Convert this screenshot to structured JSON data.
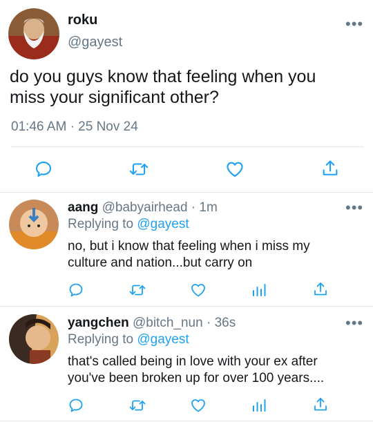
{
  "tweet": {
    "display_name": "roku",
    "handle": "@gayest",
    "text_line1": "do you guys know that feeling when you",
    "text_line2": "miss your significant other?",
    "time": "01:46 AM",
    "date_sep": "·",
    "date": "25 Nov 24"
  },
  "replies": [
    {
      "display_name": "aang",
      "handle": "@babyairhead",
      "sep": "·",
      "age": "1m",
      "replying_prefix": "Replying to",
      "replying_to": "@gayest",
      "text_line1": "no, but i know that feeling when i miss my",
      "text_line2": "culture and nation...but carry on"
    },
    {
      "display_name": "yangchen",
      "handle": "@bitch_nun",
      "sep": "·",
      "age": "36s",
      "replying_prefix": "Replying to",
      "replying_to": "@gayest",
      "text_line1": "that's called being in love with your ex after",
      "text_line2": "you've been broken up for over 100 years...."
    }
  ],
  "icons": [
    "reply-icon",
    "retweet-icon",
    "like-icon",
    "share-icon",
    "analytics-icon",
    "more-icon"
  ],
  "colors": {
    "link": "#1da1f2",
    "muted": "#657786",
    "divider": "#e1e8ed",
    "icon": "#1da1f2"
  }
}
